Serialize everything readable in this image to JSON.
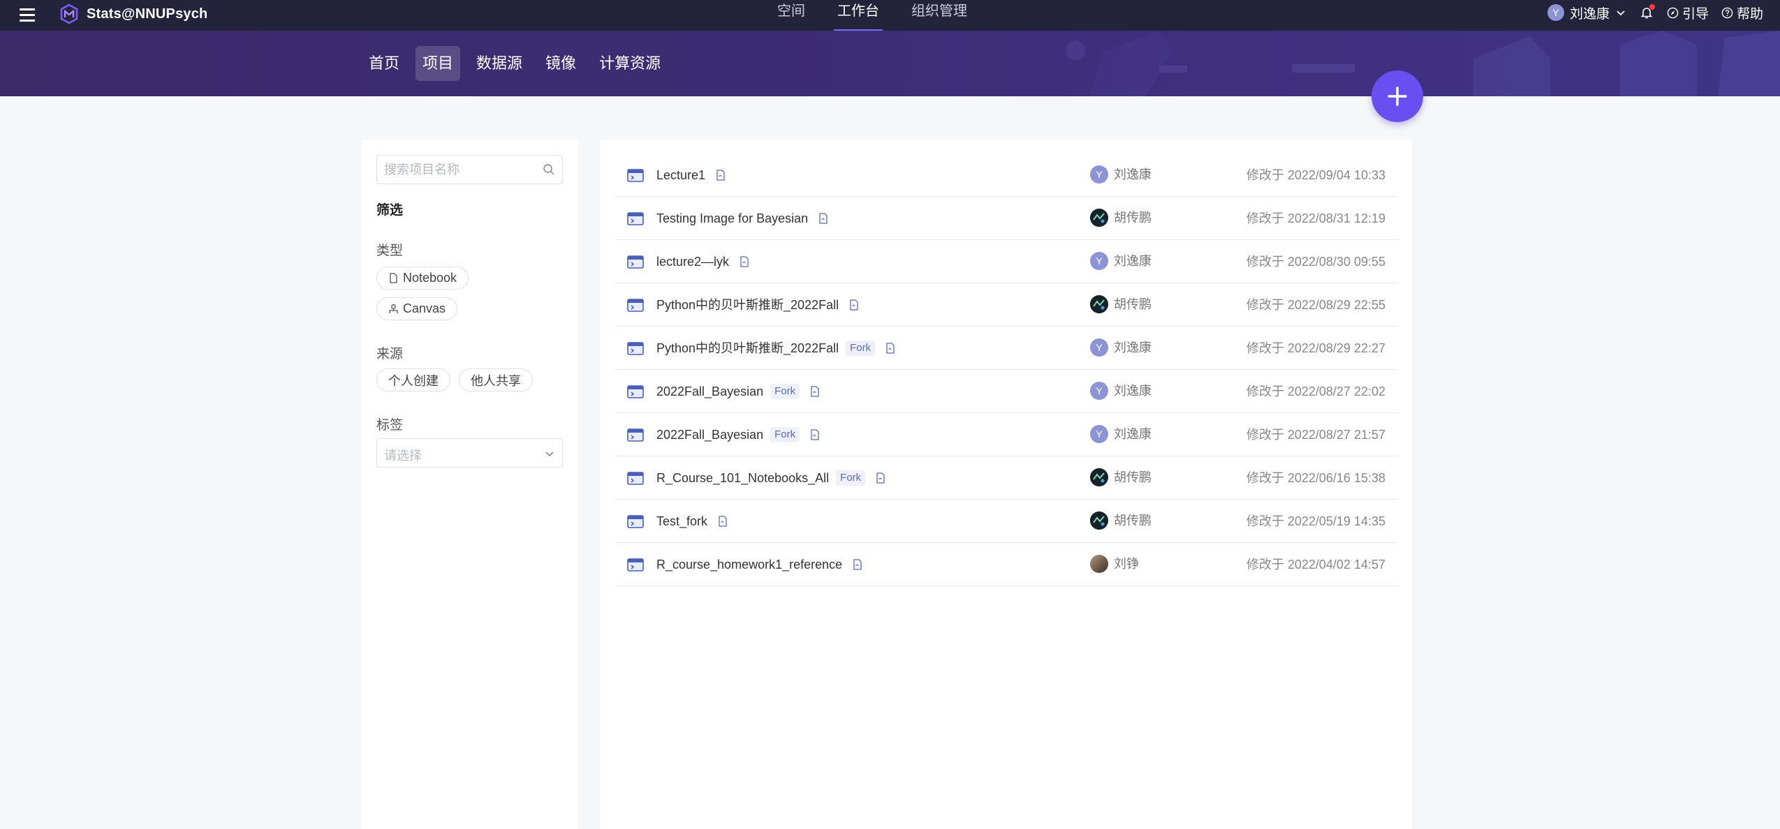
{
  "app": {
    "name": "Stats@NNUPsych"
  },
  "top_nav": [
    {
      "label": "空间",
      "active": false
    },
    {
      "label": "工作台",
      "active": true
    },
    {
      "label": "组织管理",
      "active": false
    }
  ],
  "user": {
    "initial": "Y",
    "name": "刘逸康"
  },
  "top_links": {
    "guide": "引导",
    "help": "帮助"
  },
  "sub_nav": [
    {
      "label": "首页",
      "active": false
    },
    {
      "label": "项目",
      "active": true
    },
    {
      "label": "数据源",
      "active": false
    },
    {
      "label": "镜像",
      "active": false
    },
    {
      "label": "计算资源",
      "active": false
    }
  ],
  "filter": {
    "search_placeholder": "搜索项目名称",
    "title": "筛选",
    "type_label": "类型",
    "types": [
      "Notebook",
      "Canvas"
    ],
    "source_label": "来源",
    "sources": [
      "个人创建",
      "他人共享"
    ],
    "tag_label": "标签",
    "tag_placeholder": "请选择"
  },
  "projects": [
    {
      "name": "Lecture1",
      "fork": "",
      "owner": "刘逸康",
      "avatar": "letter",
      "initial": "Y",
      "modified": "修改于 2022/09/04 10:33"
    },
    {
      "name": "Testing Image for Bayesian",
      "fork": "",
      "owner": "胡传鹏",
      "avatar": "dark",
      "initial": "",
      "modified": "修改于 2022/08/31 12:19"
    },
    {
      "name": "lecture2—lyk",
      "fork": "",
      "owner": "刘逸康",
      "avatar": "letter",
      "initial": "Y",
      "modified": "修改于 2022/08/30 09:55"
    },
    {
      "name": "Python中的贝叶斯推断_2022Fall",
      "fork": "",
      "owner": "胡传鹏",
      "avatar": "dark",
      "initial": "",
      "modified": "修改于 2022/08/29 22:55"
    },
    {
      "name": "Python中的贝叶斯推断_2022Fall",
      "fork": "Fork",
      "owner": "刘逸康",
      "avatar": "letter",
      "initial": "Y",
      "modified": "修改于 2022/08/29 22:27"
    },
    {
      "name": "2022Fall_Bayesian",
      "fork": "Fork",
      "owner": "刘逸康",
      "avatar": "letter",
      "initial": "Y",
      "modified": "修改于 2022/08/27 22:02"
    },
    {
      "name": "2022Fall_Bayesian",
      "fork": "Fork",
      "owner": "刘逸康",
      "avatar": "letter",
      "initial": "Y",
      "modified": "修改于 2022/08/27 21:57"
    },
    {
      "name": "R_Course_101_Notebooks_All",
      "fork": "Fork",
      "owner": "胡传鹏",
      "avatar": "dark",
      "initial": "",
      "modified": "修改于 2022/06/16 15:38"
    },
    {
      "name": "Test_fork",
      "fork": "",
      "owner": "胡传鹏",
      "avatar": "dark",
      "initial": "",
      "modified": "修改于 2022/05/19 14:35"
    },
    {
      "name": "R_course_homework1_reference",
      "fork": "",
      "owner": "刘铮",
      "avatar": "photo",
      "initial": "",
      "modified": "修改于 2022/04/02 14:57"
    }
  ],
  "colors": {
    "topbar": "#23243b",
    "hero": "#3c2c73",
    "accent": "#6a4ff0",
    "avatar_letter": "#8d94d6"
  }
}
